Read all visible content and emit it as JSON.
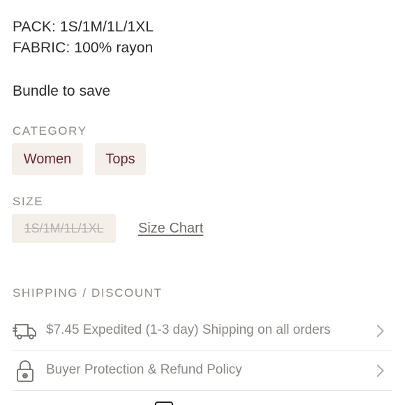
{
  "description": {
    "pack_line": "PACK: 1S/1M/1L/1XL",
    "fabric_line": "FABRIC: 100% rayon",
    "bundle_line": "Bundle to save"
  },
  "category": {
    "heading": "CATEGORY",
    "chips": [
      "Women",
      "Tops"
    ]
  },
  "size": {
    "heading": "SIZE",
    "selected_unavailable": "1S/1M/1L/1XL",
    "size_chart_link": "Size Chart"
  },
  "shipping": {
    "heading": "SHIPPING / DISCOUNT",
    "rows": [
      {
        "icon": "truck-icon",
        "label": "$7.45 Expedited (1-3 day) Shipping on all orders"
      },
      {
        "icon": "lock-icon",
        "label": "Buyer Protection & Refund Policy"
      }
    ]
  },
  "colors": {
    "chip_bg": "#f5efea",
    "chip_text": "#6b2430",
    "muted_text": "#8f8a86",
    "divider": "#e6e3e0"
  }
}
